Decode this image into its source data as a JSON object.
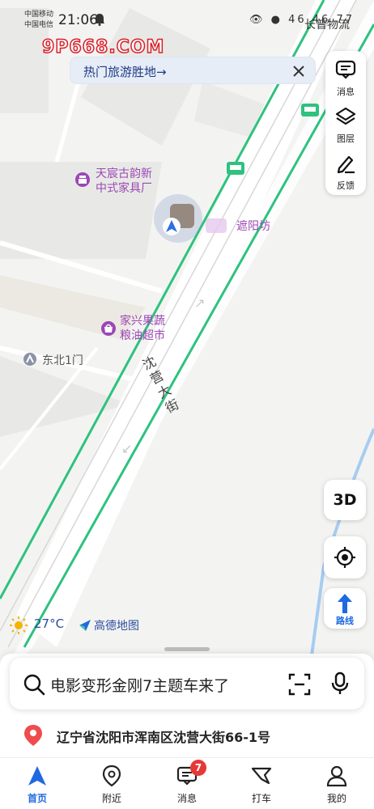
{
  "status_bar": {
    "carrier_1": "中国移动",
    "carrier_2": "中国电信",
    "time": "21:06",
    "right_icons": "👁 ● 46 46 77"
  },
  "watermark": "9P668.COM",
  "banner": {
    "text": "热门旅游胜地→"
  },
  "right_panel": {
    "messages_label": "消息",
    "layers_label": "图层",
    "feedback_label": "反馈"
  },
  "map": {
    "poi_furniture_line1": "天宸古韵新",
    "poi_furniture_line2": "中式家具厂",
    "poi_supermarket_line1": "家兴果蔬",
    "poi_supermarket_line2": "粮油超市",
    "poi_awning": "遮阳坊",
    "gate": "东北1门",
    "road": "沈营大街",
    "top_right_label": "长普物流"
  },
  "controls": {
    "three_d": "3D",
    "route_label": "路线"
  },
  "weather": {
    "temperature": "27°C"
  },
  "brand": {
    "name": "高德地图"
  },
  "search": {
    "placeholder": "电影变形金刚7主题车来了"
  },
  "location": {
    "address": "辽宁省沈阳市浑南区沈营大街66-1号"
  },
  "tabbar": {
    "home": "首页",
    "nearby": "附近",
    "messages": "消息",
    "messages_badge": "7",
    "taxi": "打车",
    "mine": "我的"
  },
  "colors": {
    "accent": "#1f6ae0",
    "road_green": "#2ec27e",
    "poi_purple": "#9b47b5",
    "badge_red": "#e53935"
  }
}
